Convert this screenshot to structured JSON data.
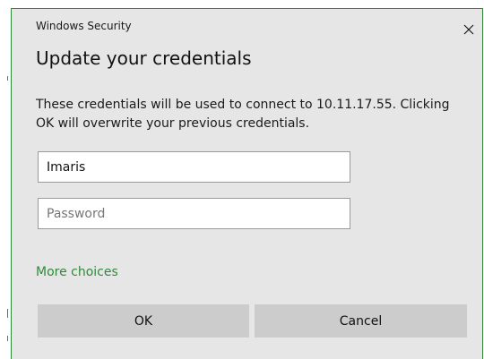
{
  "dialog": {
    "window_title": "Windows Security",
    "heading": "Update your credentials",
    "message": "These credentials will be used to connect to 10.11.17.55. Clicking OK will overwrite your previous credentials.",
    "close_icon": "close-icon",
    "username": {
      "value": "Imaris",
      "placeholder": ""
    },
    "password": {
      "value": "",
      "placeholder": "Password"
    },
    "more_choices_label": "More choices",
    "ok_label": "OK",
    "cancel_label": "Cancel"
  },
  "colors": {
    "dialog_background": "#e6e6e6",
    "accent_link": "#2e8b3a",
    "button_background": "#cccccc"
  }
}
